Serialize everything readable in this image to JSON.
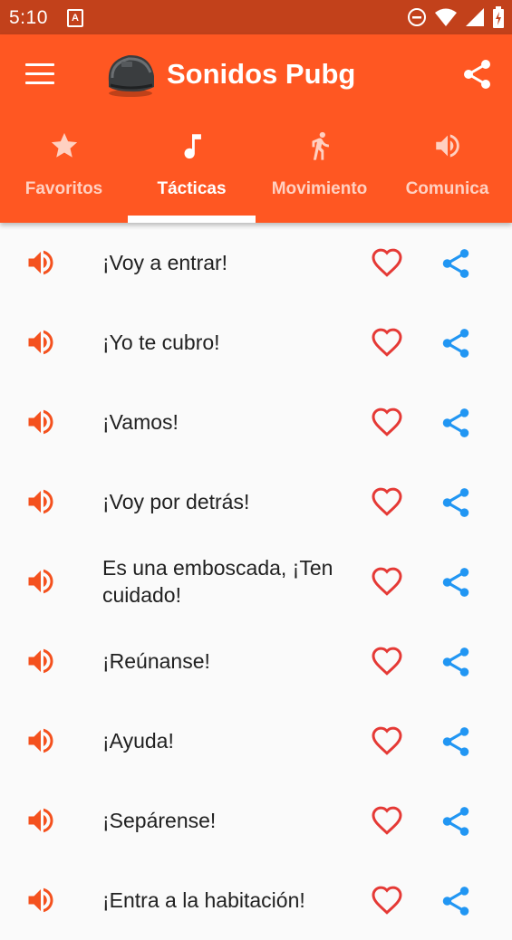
{
  "status_bar": {
    "time": "5:10",
    "notification_letter": "A"
  },
  "app_bar": {
    "title": "Sonidos Pubg",
    "background_color": "#ff5722",
    "status_bar_color": "#c2411b"
  },
  "tabs": [
    {
      "label": "Favoritos",
      "icon": "star-icon",
      "active": false
    },
    {
      "label": "Tácticas",
      "icon": "music-note-icon",
      "active": true
    },
    {
      "label": "Movimiento",
      "icon": "running-person-icon",
      "active": false
    },
    {
      "label": "Comunica",
      "icon": "speaker-icon",
      "active": false
    }
  ],
  "sounds": [
    {
      "label": "¡Voy a entrar!"
    },
    {
      "label": "¡Yo te cubro!"
    },
    {
      "label": "¡Vamos!"
    },
    {
      "label": "¡Voy por detrás!"
    },
    {
      "label": "Es una emboscada, ¡Ten cuidado!"
    },
    {
      "label": "¡Reúnanse!"
    },
    {
      "label": "¡Ayuda!"
    },
    {
      "label": "¡Sepárense!"
    },
    {
      "label": "¡Entra a la habitación!"
    }
  ],
  "colors": {
    "speaker": "#f4511e",
    "heart": "#e53935",
    "share": "#2196f3"
  }
}
